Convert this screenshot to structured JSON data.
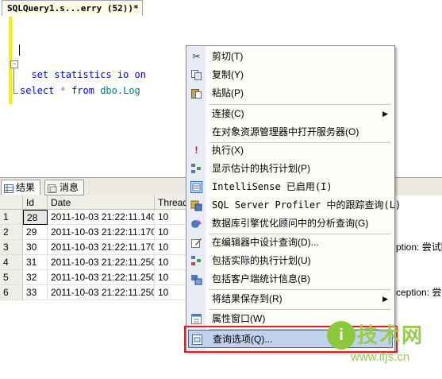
{
  "editor": {
    "tab_title": "SQLQuery1.s...erry (52))*",
    "lines": [
      {
        "kw": "set statistics io on"
      },
      {
        "kw": "select",
        "op": "*",
        "kw2": "from",
        "id": "dbo.Log"
      }
    ]
  },
  "results": {
    "tabs": [
      {
        "label": "结果",
        "icon": "grid-icon"
      },
      {
        "label": "消息",
        "icon": "messages-icon"
      }
    ],
    "columns": [
      "",
      "Id",
      "Date",
      "Thread"
    ],
    "rows": [
      {
        "n": "1",
        "id": "28",
        "date": "2011-10-03 21:22:11.140",
        "thread": "10"
      },
      {
        "n": "2",
        "id": "29",
        "date": "2011-10-03 21:22:11.170",
        "thread": "10"
      },
      {
        "n": "3",
        "id": "30",
        "date": "2011-10-03 21:22:11.170",
        "thread": "10"
      },
      {
        "n": "4",
        "id": "31",
        "date": "2011-10-03 21:22:11.250",
        "thread": "10"
      },
      {
        "n": "5",
        "id": "32",
        "date": "2011-10-03 21:22:11.250",
        "thread": "10"
      },
      {
        "n": "6",
        "id": "33",
        "date": "2011-10-03 21:22:11.250",
        "thread": "10"
      }
    ],
    "overflow_text": "ption: 尝试除以",
    "overflow_text_2": "ception: 尝试除以"
  },
  "menu": {
    "items": [
      {
        "label": "剪切(T)",
        "icon": "scissors-icon"
      },
      {
        "label": "复制(Y)",
        "icon": "copy-icon"
      },
      {
        "label": "粘贴(P)",
        "icon": "paste-icon"
      },
      {
        "label": "连接(C)"
      },
      {
        "label": "在对象资源管理器中打开服务器(O)"
      },
      {
        "label": "执行(X)",
        "icon": "execute-icon"
      },
      {
        "label": "显示估计的执行计划(P)",
        "icon": "estimated-plan-icon"
      },
      {
        "label": "IntelliSense 已启用(I)",
        "icon": "intellisense-icon"
      },
      {
        "label": "SQL Server Profiler 中的跟踪查询(L)",
        "icon": "profiler-icon"
      },
      {
        "label": "数据库引擎优化顾问中的分析查询(G)",
        "icon": "tuning-advisor-icon"
      },
      {
        "label": "在编辑器中设计查询(D)...",
        "icon": "design-query-icon"
      },
      {
        "label": "包括实际的执行计划(U)",
        "icon": "actual-plan-icon"
      },
      {
        "label": "包括客户端统计信息(B)",
        "icon": "client-stats-icon"
      },
      {
        "label": "将结果保存到(R)"
      },
      {
        "label": "属性窗口(W)",
        "icon": "properties-icon"
      },
      {
        "label": "查询选项(Q)...",
        "icon": "query-options-icon"
      }
    ]
  },
  "watermark": {
    "logo_letter": "i",
    "title": "技术网",
    "url": "www.itjs.cn"
  },
  "colors": {
    "keyword": "#0000ff",
    "operator": "#808080",
    "identifier": "#008080",
    "highlight_box": "#e02020",
    "menu_selected": "#c1d2ee",
    "watermark": "#9acb50"
  }
}
